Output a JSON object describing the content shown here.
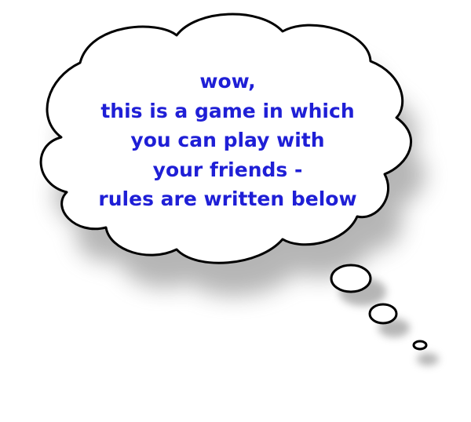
{
  "thought_bubble": {
    "lines": [
      "wow,",
      "this is a game in which",
      "you can play with",
      "your friends -",
      "rules are written below"
    ],
    "text_color": "#1f1fd6",
    "outline_color": "#000000",
    "fill_color": "#ffffff",
    "shadow_color": "#7a7a7a"
  }
}
